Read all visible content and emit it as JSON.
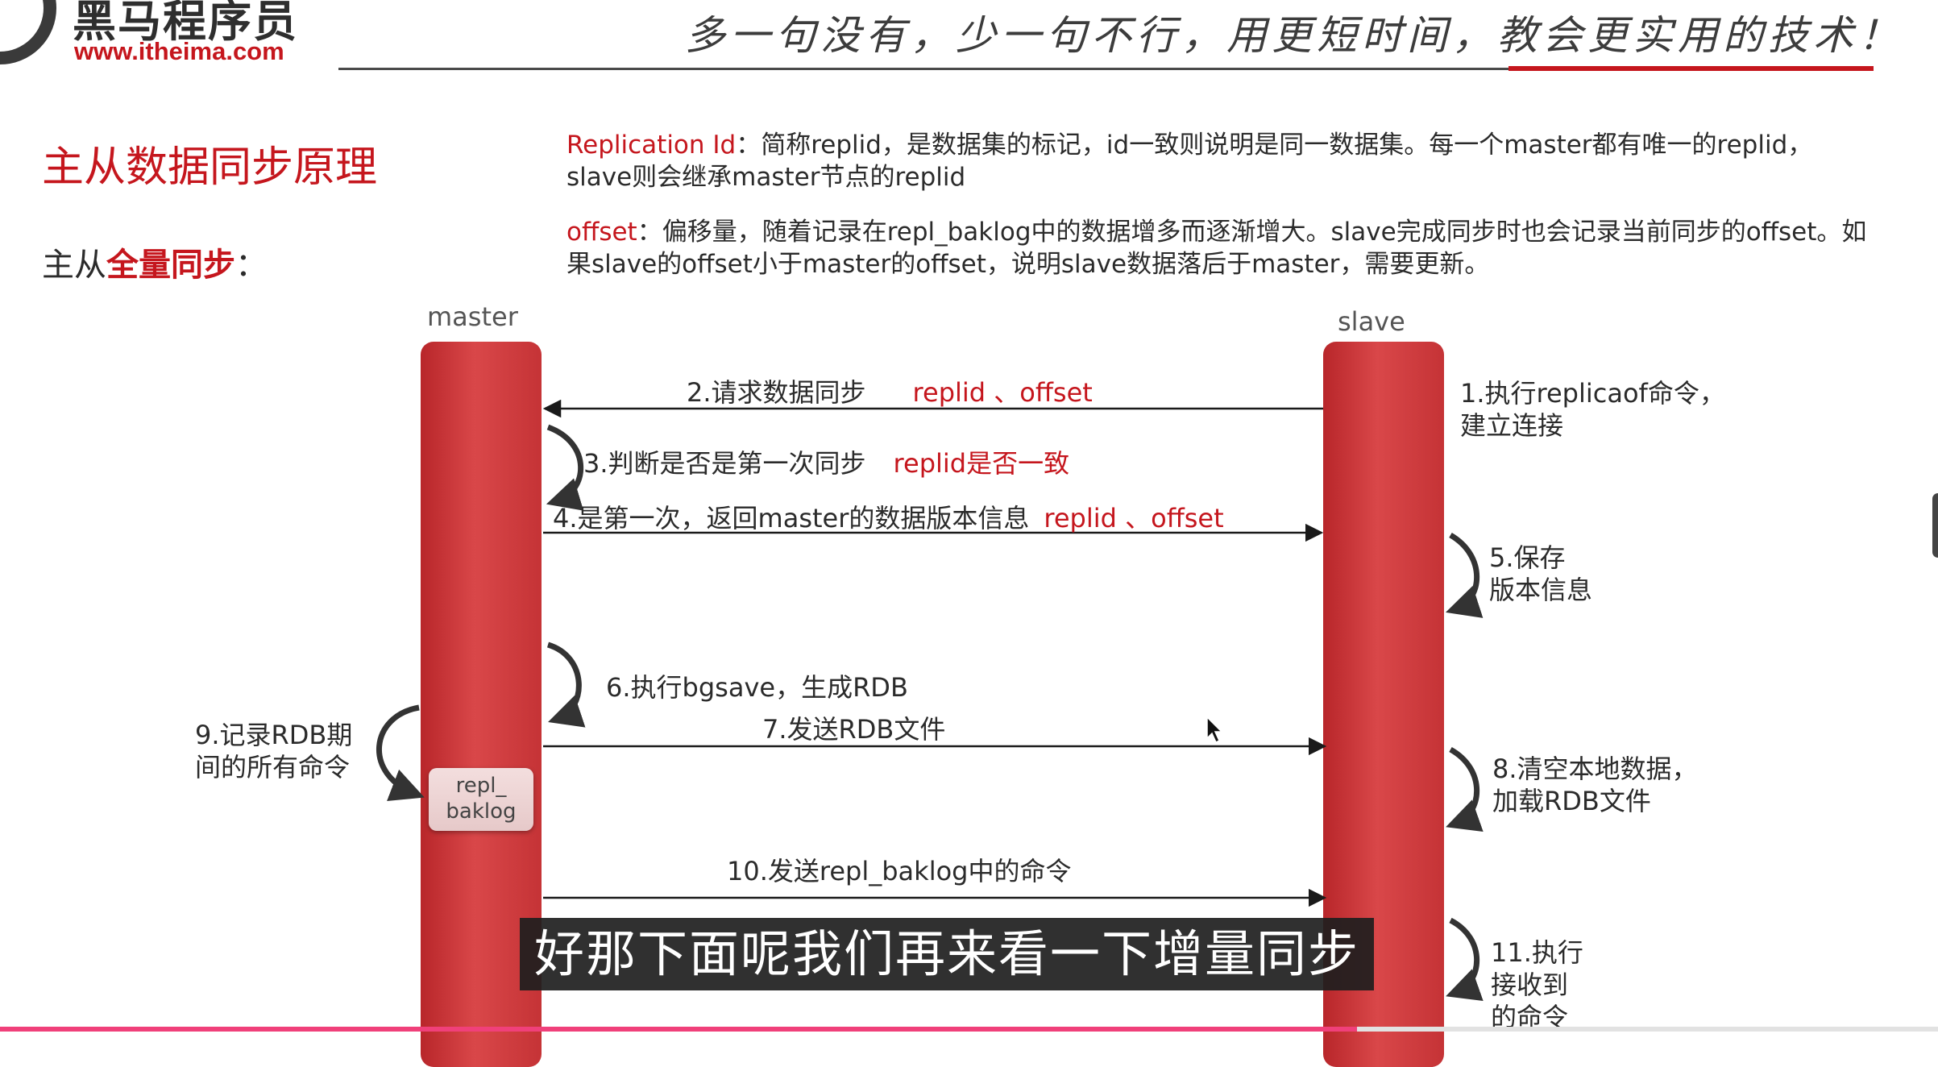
{
  "header": {
    "logo_cn": "黑马程序员",
    "logo_url": "www.itheima.com",
    "slogan": "多一句没有，少一句不行，用更短时间，教会更实用的技术！"
  },
  "page_title": "主从数据同步原理",
  "sub_title": {
    "prefix": "主从",
    "highlight": "全量同步",
    "suffix": "："
  },
  "definitions": [
    {
      "term": "Replication Id",
      "text": "：简称replid，是数据集的标记，id一致则说明是同一数据集。每一个master都有唯一的replid，slave则会继承master节点的replid"
    },
    {
      "term": "offset",
      "text": "：偏移量，随着记录在repl_baklog中的数据增多而逐渐增大。slave完成同步时也会记录当前同步的offset。如果slave的offset小于master的offset，说明slave数据落后于master，需要更新。"
    }
  ],
  "diagram": {
    "master_label": "master",
    "slave_label": "slave",
    "baklog_line1": "repl_",
    "baklog_line2": "baklog",
    "steps": {
      "s1_line1": "1.执行replicaof命令，",
      "s1_line2": "建立连接",
      "s2_text": "2.请求数据同步",
      "s2_red": "replid 、offset",
      "s3_text": "3.判断是否是第一次同步",
      "s3_red": "replid是否一致",
      "s4_text": "4.是第一次，返回master的数据版本信息",
      "s4_red": "replid 、offset",
      "s5_line1": "5.保存",
      "s5_line2": "版本信息",
      "s6_text": "6.执行bgsave，生成RDB",
      "s7_text": "7.发送RDB文件",
      "s8_line1": "8.清空本地数据，",
      "s8_line2": "加载RDB文件",
      "s9_line1": "9.记录RDB期",
      "s9_line2": "间的所有命令",
      "s10_text": "10.发送repl_baklog中的命令",
      "s11_line1": "11.执行",
      "s11_line2": "接收到",
      "s11_line3": "的命令"
    }
  },
  "caption": "好那下面呢我们再来看一下增量同步",
  "colors": {
    "accent_red": "#c5161d",
    "lane_red": "#d94749",
    "text": "#2b2b2b"
  },
  "video_progress": 0.7
}
